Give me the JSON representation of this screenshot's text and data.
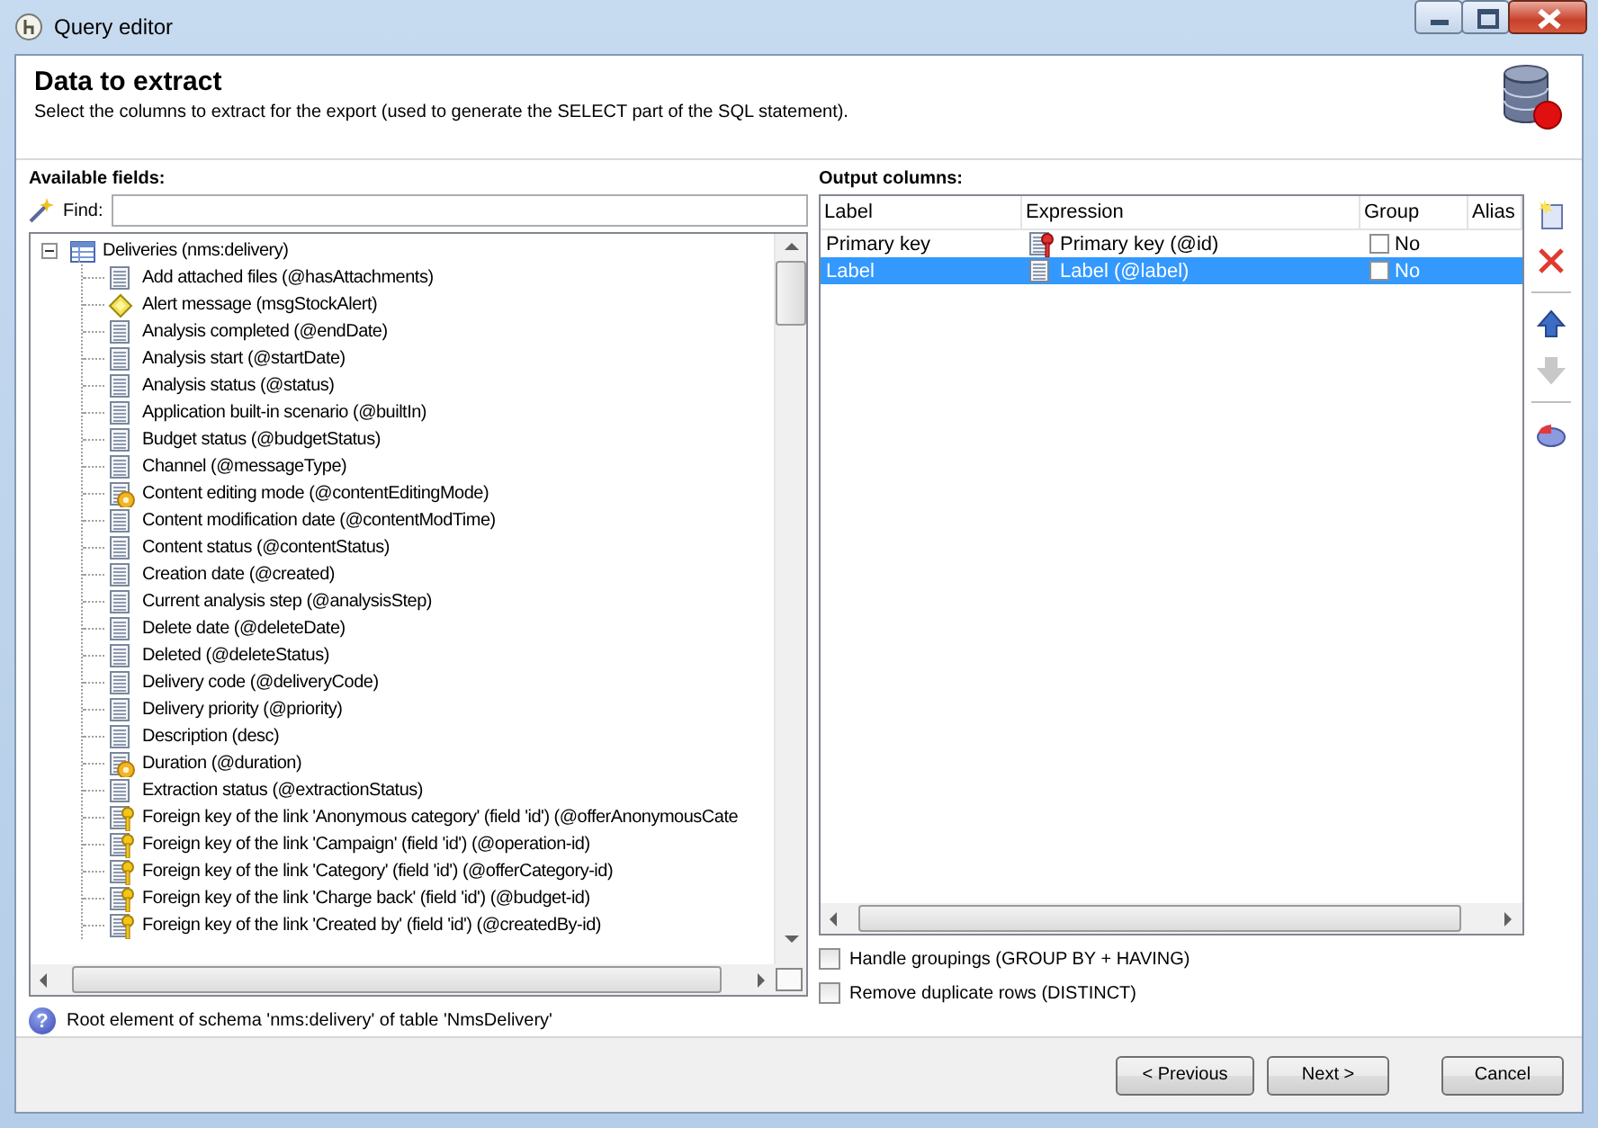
{
  "window": {
    "title": "Query editor"
  },
  "header": {
    "title": "Data to extract",
    "description": "Select the columns to extract for the export (used to generate the SELECT part of the SQL statement)."
  },
  "available_fields": {
    "label": "Available fields:",
    "find_label": "Find:",
    "tree": {
      "label": "Deliveries (nms:delivery)",
      "expanded": true,
      "children": [
        {
          "label": "Add attached files (@hasAttachments)",
          "kind": "field"
        },
        {
          "label": "Alert message (msgStockAlert)",
          "kind": "alert"
        },
        {
          "label": "Analysis completed (@endDate)",
          "kind": "field"
        },
        {
          "label": "Analysis start (@startDate)",
          "kind": "field"
        },
        {
          "label": "Analysis status (@status)",
          "kind": "field"
        },
        {
          "label": "Application built-in scenario (@builtIn)",
          "kind": "field"
        },
        {
          "label": "Budget status (@budgetStatus)",
          "kind": "field"
        },
        {
          "label": "Channel (@messageType)",
          "kind": "field"
        },
        {
          "label": "Content editing mode (@contentEditingMode)",
          "kind": "computed"
        },
        {
          "label": "Content modification date (@contentModTime)",
          "kind": "field"
        },
        {
          "label": "Content status (@contentStatus)",
          "kind": "field"
        },
        {
          "label": "Creation date (@created)",
          "kind": "field"
        },
        {
          "label": "Current analysis step (@analysisStep)",
          "kind": "field"
        },
        {
          "label": "Delete date (@deleteDate)",
          "kind": "field"
        },
        {
          "label": "Deleted (@deleteStatus)",
          "kind": "field"
        },
        {
          "label": "Delivery code (@deliveryCode)",
          "kind": "field"
        },
        {
          "label": "Delivery priority (@priority)",
          "kind": "field"
        },
        {
          "label": "Description (desc)",
          "kind": "field"
        },
        {
          "label": "Duration (@duration)",
          "kind": "computed"
        },
        {
          "label": "Extraction status (@extractionStatus)",
          "kind": "field"
        },
        {
          "label": "Foreign key of the link 'Anonymous category' (field 'id') (@offerAnonymousCate",
          "kind": "key"
        },
        {
          "label": "Foreign key of the link 'Campaign' (field 'id') (@operation-id)",
          "kind": "key"
        },
        {
          "label": "Foreign key of the link 'Category' (field 'id') (@offerCategory-id)",
          "kind": "key"
        },
        {
          "label": "Foreign key of the link 'Charge back' (field 'id') (@budget-id)",
          "kind": "key"
        },
        {
          "label": "Foreign key of the link 'Created by' (field 'id') (@createdBy-id)",
          "kind": "key"
        }
      ]
    }
  },
  "output_columns": {
    "label": "Output columns:",
    "columns": [
      "Label",
      "Expression",
      "Group",
      "Alias"
    ],
    "rows": [
      {
        "label": "Primary key",
        "expression": "Primary key (@id)",
        "kind": "key",
        "group_checked": false,
        "group": "No",
        "selected": false
      },
      {
        "label": "Label",
        "expression": "Label (@label)",
        "kind": "field",
        "group_checked": false,
        "group": "No",
        "selected": true
      }
    ],
    "tools": [
      {
        "kind": "add",
        "disabled": false
      },
      {
        "kind": "delete",
        "disabled": false
      },
      {
        "kind": "up",
        "disabled": false
      },
      {
        "kind": "down",
        "disabled": true
      },
      {
        "kind": "chart",
        "disabled": false
      }
    ]
  },
  "options": [
    {
      "label": "Handle groupings (GROUP BY + HAVING)",
      "checked": false
    },
    {
      "label": "Remove duplicate rows (DISTINCT)",
      "checked": false
    }
  ],
  "status": {
    "icon": "?",
    "text": "Root element of schema 'nms:delivery' of table 'NmsDelivery'"
  },
  "buttons": [
    {
      "label": "< Previous"
    },
    {
      "label": "Next >"
    },
    {
      "label": "Cancel"
    }
  ]
}
